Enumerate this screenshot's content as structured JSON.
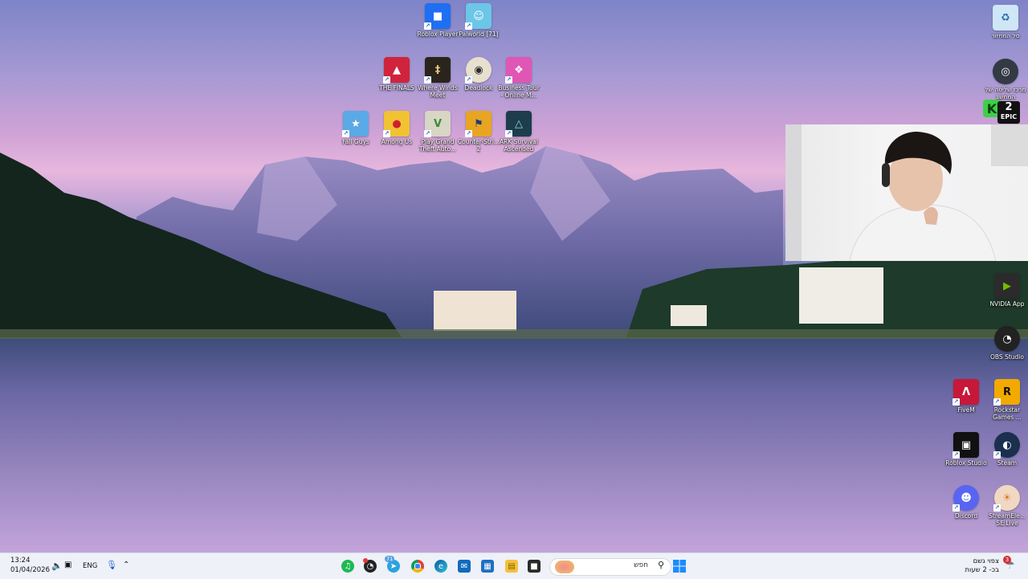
{
  "desktop_icons": [
    {
      "label": "Roblox Player",
      "glyph": "■",
      "color": "#1f6ff2",
      "icon": "roblox-icon"
    },
    {
      "label": "Palworld [71]",
      "glyph": "☺",
      "color": "#6cc6e8",
      "icon": "palworld-icon"
    },
    {
      "label": "THE FINALS",
      "glyph": "▲",
      "color": "#d0243c",
      "icon": "the-finals-icon"
    },
    {
      "label": "Where Winds Meet",
      "glyph": "‡",
      "color": "#2b241c",
      "icon": "where-winds-meet-icon"
    },
    {
      "label": "Deadlock",
      "glyph": "◉",
      "color": "#e7e0cf",
      "icon": "deadlock-icon"
    },
    {
      "label": "Business Tour - Online M...",
      "glyph": "❖",
      "color": "#e056b4",
      "icon": "business-tour-icon"
    },
    {
      "label": "Fall Guys",
      "glyph": "★",
      "color": "#5aa9e6",
      "icon": "fall-guys-icon"
    },
    {
      "label": "Among Us",
      "glyph": "●",
      "color": "#d11f2d",
      "icon": "among-us-icon"
    },
    {
      "label": "Play Grand Theft Auto...",
      "glyph": "V",
      "color": "#3b8b3a",
      "icon": "gta-v-icon"
    },
    {
      "label": "Counter-Stri... 2",
      "glyph": "⚑",
      "color": "#e8a522",
      "icon": "counter-strike-icon"
    },
    {
      "label": "ARK Survival Ascended",
      "glyph": "△",
      "color": "#1d3d4d",
      "icon": "ark-icon"
    },
    {
      "label": "סל המחזור",
      "glyph": "♻",
      "color": "#cfe6f7",
      "icon": "recycle-bin-icon"
    },
    {
      "label": "מרכז שליטה של המחשב",
      "glyph": "◎",
      "color": "#333a44",
      "icon": "control-center-icon"
    },
    {
      "label": "NVIDIA App",
      "glyph": "▶",
      "color": "#2b2b2b",
      "icon": "nvidia-icon"
    },
    {
      "label": "OBS Studio",
      "glyph": "◔",
      "color": "#222",
      "icon": "obs-icon"
    },
    {
      "label": "FiveM",
      "glyph": "Λ",
      "color": "#c7183a",
      "icon": "fivem-icon"
    },
    {
      "label": "Rockstar Games ...",
      "glyph": "R",
      "color": "#f2a900",
      "icon": "rockstar-icon"
    },
    {
      "label": "Roblox Studio",
      "glyph": "▣",
      "color": "#111",
      "icon": "roblox-studio-icon"
    },
    {
      "label": "Steam",
      "glyph": "◐",
      "color": "#1b2f4f",
      "icon": "steam-icon"
    },
    {
      "label": "Discord",
      "glyph": "☻",
      "color": "#5865f2",
      "icon": "discord-icon"
    },
    {
      "label": "StreamEle... SE.Live",
      "glyph": "☀",
      "color": "#f0d8c2",
      "icon": "streamelements-icon"
    }
  ],
  "badges": {
    "k_icon": "K",
    "epic_count": "2",
    "epic_label": "EPIC"
  },
  "taskbar": {
    "time": "13:24",
    "date": "01/04/2026",
    "language": "ENG",
    "search_placeholder": "חפש",
    "weather_title": "צפוי גשם",
    "weather_sub": "בכ- 2 שעות",
    "weather_badge": "3",
    "telegram_badge": "71"
  }
}
